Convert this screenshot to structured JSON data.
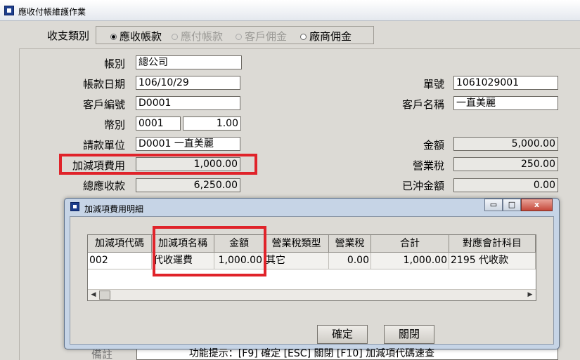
{
  "window": {
    "title": "應收付帳維護作業"
  },
  "type_selector": {
    "label": "收支類別",
    "options": [
      {
        "label": "應收帳款",
        "checked": true,
        "enabled": true
      },
      {
        "label": "應付帳款",
        "checked": false,
        "enabled": false
      },
      {
        "label": "客戶佣金",
        "checked": false,
        "enabled": false
      },
      {
        "label": "廠商佣金",
        "checked": false,
        "enabled": true
      }
    ]
  },
  "form": {
    "account_label": "帳別",
    "account_value": "總公司",
    "date_label": "帳款日期",
    "date_value": "106/10/29",
    "customer_code_label": "客戶編號",
    "customer_code_value": "D0001",
    "currency_label": "幣別",
    "currency_code": "0001",
    "currency_rate": "1.00",
    "billing_unit_label": "請款單位",
    "billing_unit_value": "D0001 一直美麗",
    "adjust_fee_label": "加減項費用",
    "adjust_fee_value": "1,000.00",
    "total_receivable_label": "總應收款",
    "total_receivable_value": "6,250.00",
    "order_no_label": "單號",
    "order_no_value": "1061029001",
    "customer_name_label": "客戶名稱",
    "customer_name_value": "一直美麗",
    "amount_label": "金額",
    "amount_value": "5,000.00",
    "tax_label": "營業稅",
    "tax_value": "250.00",
    "offset_label": "已沖金額",
    "offset_value": "0.00",
    "note_label": "備註"
  },
  "dialog": {
    "title": "加減項費用明細",
    "window_buttons": {
      "minimize": "▭",
      "maximize": "□",
      "close": "x"
    },
    "columns": [
      "加減項代碼",
      "加減項名稱",
      "金額",
      "營業稅類型",
      "營業稅",
      "合計",
      "對應會計科目"
    ],
    "rows": [
      {
        "code": "002",
        "name": "代收運費",
        "amount": "1,000.00",
        "tax_type": "其它",
        "tax": "0.00",
        "total": "1,000.00",
        "account": "2195 代收款"
      }
    ],
    "confirm_label": "確定",
    "close_label": "關閉",
    "hint": "功能提示：[F9] 確定 [ESC] 關閉  [F10] 加減項代碼速查"
  },
  "colors": {
    "highlight": "#e0232a",
    "dialog_frame": "#c6d4e6"
  },
  "icons": {
    "app": "app-window-icon",
    "scroll_left": "left-arrow-icon",
    "scroll_right": "right-arrow-icon"
  }
}
